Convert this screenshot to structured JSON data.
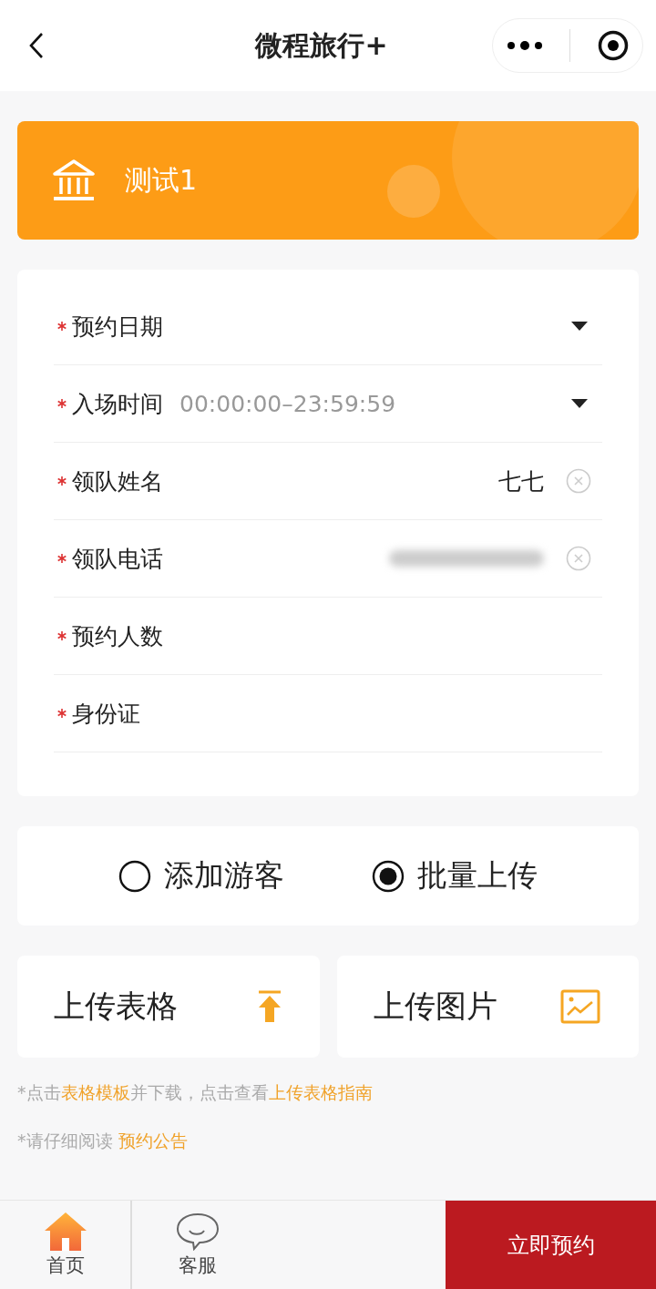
{
  "nav": {
    "title": "微程旅行+"
  },
  "banner": {
    "title": "测试1"
  },
  "form": {
    "fields": [
      {
        "kind": "select",
        "label": "预约日期",
        "required": true
      },
      {
        "kind": "select",
        "label": "入场时间",
        "required": true,
        "placeholder": "00:00:00–23:59:59"
      },
      {
        "kind": "input",
        "label": "领队姓名",
        "required": true,
        "value": "七七",
        "clearable": true
      },
      {
        "kind": "input",
        "label": "领队电话",
        "required": true,
        "redacted": true,
        "clearable": true
      },
      {
        "kind": "input",
        "label": "预约人数",
        "required": true
      },
      {
        "kind": "input",
        "label": "身份证",
        "required": true
      }
    ]
  },
  "mode": [
    {
      "label": "添加游客",
      "selected": false
    },
    {
      "label": "批量上传",
      "selected": true
    }
  ],
  "uploads": [
    {
      "kind": "table",
      "label": "上传表格"
    },
    {
      "kind": "image",
      "label": "上传图片"
    }
  ],
  "hints": [
    [
      {
        "text": "*点击",
        "link": false
      },
      {
        "text": "表格模板",
        "link": true
      },
      {
        "text": "并下载，点击查看",
        "link": false
      },
      {
        "text": "上传表格指南",
        "link": true
      }
    ],
    [
      {
        "text": "*请仔细阅读 ",
        "link": false
      },
      {
        "text": "预约公告",
        "link": true
      }
    ]
  ],
  "tabbar": {
    "items": [
      {
        "kind": "home",
        "label": "首页"
      },
      {
        "kind": "chat",
        "label": "客服"
      }
    ],
    "action": "立即预约"
  }
}
